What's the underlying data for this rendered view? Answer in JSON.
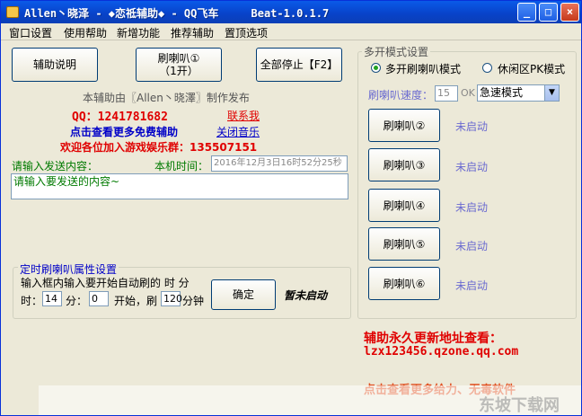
{
  "window": {
    "title": "Allen丶晓泽 - ◆恋祗辅助◆ - QQ飞车     Beat-1.0.1.7",
    "controls": {
      "minimize": "_",
      "maximize": "□",
      "close": "×"
    }
  },
  "menu": [
    "窗口设置",
    "使用帮助",
    "新增功能",
    "推荐辅助",
    "置顶选项"
  ],
  "buttons": {
    "help": "辅助说明",
    "horn_1_line1": "刷喇叭①",
    "horn_1_line2": "（1开）",
    "stop_all": "全部停止【F2】",
    "confirm": "确定"
  },
  "info": {
    "publisher": "本辅助由〖Allen丶晓澤〗制作发布",
    "qq": "QQ：1241781682",
    "contact": "联系我",
    "more_free": "点击查看更多免费辅助",
    "close_music": "关闭音乐",
    "group": "欢迎各位加入游戏娱乐群：135507151"
  },
  "send": {
    "label": "请输入发送内容：",
    "time_label": "本机时间：",
    "time_value": "2016年12月3日16时52分25秒",
    "content_value": "请输入要发送的内容~"
  },
  "timer": {
    "group_title": "定时刷喇叭属性设置",
    "desc": "输入框内输入要开始自动刷的 时   分",
    "hour_label": "时：",
    "hour_value": "14",
    "minute_label": "分：",
    "minute_value": "0",
    "start_label": "开始，刷",
    "count_value": "120",
    "unit_label": "分钟",
    "status": "暂未启动"
  },
  "multi": {
    "group_title": "多开模式设置",
    "mode_horn": "多开刷喇叭模式",
    "mode_idle": "休闲区PK模式",
    "speed_label": "刷喇叭速度：",
    "speed_value": "15",
    "ok_label": "OK",
    "speed_mode": "急速模式",
    "horns": [
      {
        "label": "刷喇叭②",
        "status": "未启动"
      },
      {
        "label": "刷喇叭③",
        "status": "未启动"
      },
      {
        "label": "刷喇叭④",
        "status": "未启动"
      },
      {
        "label": "刷喇叭⑤",
        "status": "未启动"
      },
      {
        "label": "刷喇叭⑥",
        "status": "未启动"
      }
    ]
  },
  "footer": {
    "update_title": "辅助永久更新地址查看：",
    "update_url": "lzx123456.qzone.qq.com",
    "more_soft": "点击查看更多给力、无毒软件",
    "watermark": "东坡下载网"
  },
  "colors": {
    "title_bar": "#0842c8",
    "red_text": "#e00000",
    "blue_text": "#0000c8",
    "status_text": "#6a6ad0"
  }
}
